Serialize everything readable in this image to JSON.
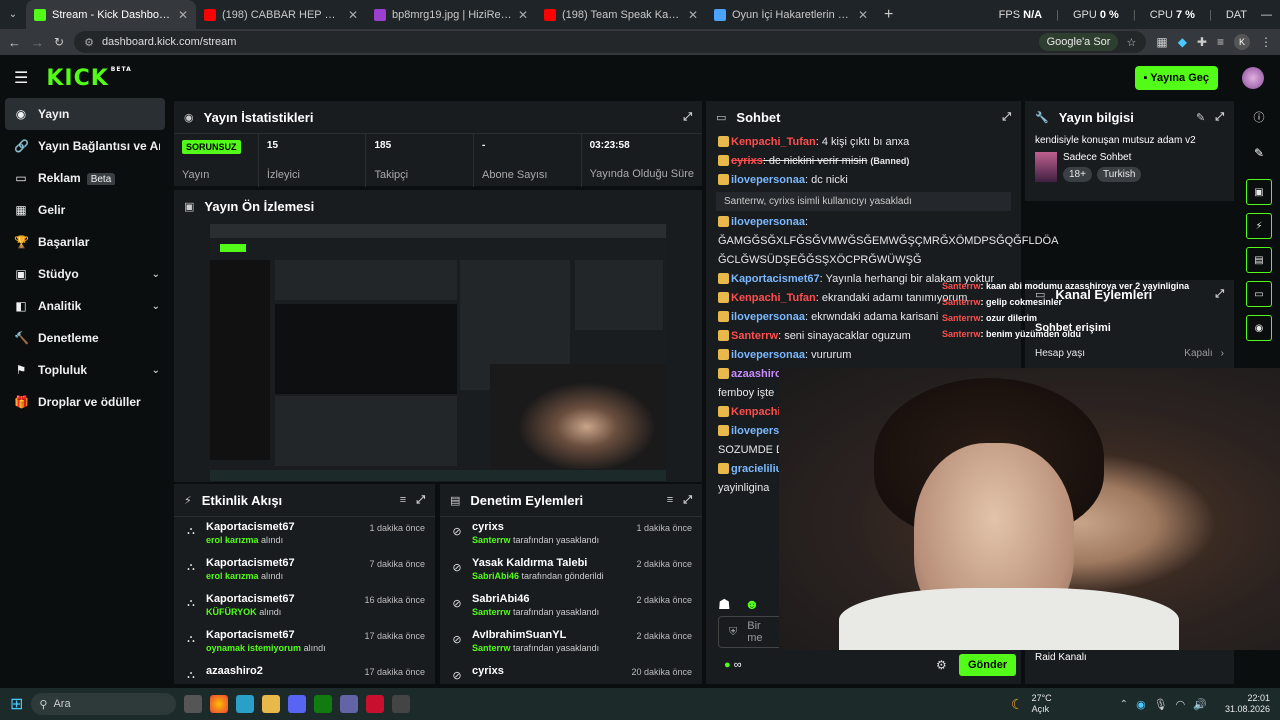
{
  "browser": {
    "tabs": [
      {
        "title": "Stream - Kick Dashboard",
        "color": "#53fc18",
        "active": true
      },
      {
        "title": "(198) CABBAR HEP HAKLIYDI - ",
        "color": "#ff0000"
      },
      {
        "title": "bp8mrg19.jpg | HiziResim",
        "color": "#9b3fd1"
      },
      {
        "title": "(198) Team Speak Kavga [Kopti",
        "color": "#ff0000"
      },
      {
        "title": "Oyun İçi Hakaretlerin Hukuki Bo",
        "color": "#4aa3ff"
      }
    ],
    "stats": {
      "fps_label": "FPS",
      "fps": "N/A",
      "gpu_label": "GPU",
      "gpu": "0 %",
      "cpu_label": "CPU",
      "cpu": "7 %",
      "dat_label": "DAT"
    },
    "url": "dashboard.kick.com/stream",
    "google_button": "Google'a Sor",
    "profile_initial": "K"
  },
  "header": {
    "logo": "KICK",
    "logo_sup": "BETA",
    "go_live": "Yayına Geç"
  },
  "sidebar": {
    "items": [
      {
        "label": "Yayın",
        "icon": "◉",
        "active": true
      },
      {
        "label": "Yayın Bağlantısı ve Anahtar",
        "icon": "🔗"
      },
      {
        "label": "Reklam",
        "icon": "▭",
        "badge": "Beta"
      },
      {
        "label": "Gelir",
        "icon": "▦"
      },
      {
        "label": "Başarılar",
        "icon": "🏆"
      },
      {
        "label": "Stüdyo",
        "icon": "▣",
        "chevron": true
      },
      {
        "label": "Analitik",
        "icon": "◧",
        "chevron": true
      },
      {
        "label": "Denetleme",
        "icon": "🔨"
      },
      {
        "label": "Topluluk",
        "icon": "⚑",
        "chevron": true
      },
      {
        "label": "Droplar ve ödüller",
        "icon": "🎁"
      }
    ]
  },
  "stats_panel": {
    "title": "Yayın İstatistikleri",
    "status_badge": "SORUNSUZ",
    "status_label": "Yayın",
    "items": [
      {
        "value": "15",
        "label": "İzleyici"
      },
      {
        "value": "185",
        "label": "Takipçi"
      },
      {
        "value": "-",
        "label": "Abone Sayısı"
      },
      {
        "value": "03:23:58",
        "label": "Yayında Olduğu Süre"
      }
    ]
  },
  "preview_panel": {
    "title": "Yayın Ön İzlemesi"
  },
  "activity_panel": {
    "title": "Etkinlik Akışı",
    "rows": [
      {
        "name": "Kaportacismet67",
        "highlight": "erol karızma",
        "suffix": "alındı",
        "time": "1 dakika önce"
      },
      {
        "name": "Kaportacismet67",
        "highlight": "erol karızma",
        "suffix": "alındı",
        "time": "7 dakika önce"
      },
      {
        "name": "Kaportacismet67",
        "highlight": "KÜFÜRYOK",
        "suffix": "alındı",
        "time": "16 dakika önce"
      },
      {
        "name": "Kaportacismet67",
        "highlight": "oynamak istemiyorum",
        "suffix": "alındı",
        "time": "17 dakika önce"
      },
      {
        "name": "azaashiro2",
        "highlight": "",
        "suffix": "",
        "time": "17 dakika önce"
      }
    ]
  },
  "moderation_panel": {
    "title": "Denetim Eylemleri",
    "rows": [
      {
        "name": "cyrixs",
        "highlight": "Santerrw",
        "suffix": "tarafından yasaklandı",
        "time": "1 dakika önce"
      },
      {
        "name": "Yasak Kaldırma Talebi",
        "highlight": "SabriAbi46",
        "suffix": "tarafından gönderildi",
        "time": "2 dakika önce"
      },
      {
        "name": "SabriAbi46",
        "highlight": "Santerrw",
        "suffix": "tarafından yasaklandı",
        "time": "2 dakika önce"
      },
      {
        "name": "AvIbrahimSuanYL",
        "highlight": "Santerrw",
        "suffix": "tarafından yasaklandı",
        "time": "2 dakika önce"
      },
      {
        "name": "cyrixs",
        "highlight": "",
        "suffix": "",
        "time": "20 dakika önce"
      }
    ]
  },
  "chat_panel": {
    "title": "Sohbet",
    "messages": [
      {
        "user": "Kenpachi_Tufan",
        "color": "#ff4d4d",
        "text": ": 4 kişi çıktı bı anxa"
      },
      {
        "user": "cyrixs",
        "color": "#ff4d4d",
        "text": ": dc nickini verir misin",
        "note": "(Banned)",
        "struck": true
      },
      {
        "user": "ilovepersonaa",
        "color": "#7ab8ff",
        "text": ": dc nicki"
      },
      {
        "system": "Santerrw, cyrixs isimli kullanıcıyı yasakladı"
      },
      {
        "user": "ilovepersonaa",
        "color": "#7ab8ff",
        "text": ":"
      },
      {
        "text": "ĞAMGĞSĞXLFĞSĞVMWĞSĞEMWĞŞÇMRĞXÖMDPSĞQĞFLDÖA"
      },
      {
        "text": "ĞCLĞWSÜDŞEĞĞSŞXÖCPRĞWÜWŞĞ"
      },
      {
        "user": "Kaportacismet67",
        "color": "#7ab8ff",
        "text": ": Yayınla herhangi bir alakam yoktur"
      },
      {
        "user": "Kenpachi_Tufan",
        "color": "#ff4d4d",
        "text": ": ekrandaki adamı tanımıyorum"
      },
      {
        "user": "ilovepersonaa",
        "color": "#7ab8ff",
        "text": ": ekrwndaki adama karisani"
      },
      {
        "user": "Santerrw",
        "color": "#ff4d4d",
        "text": ": seni sinayacaklar oguzum"
      },
      {
        "user": "ilovepersonaa",
        "color": "#7ab8ff",
        "text": ": vururum"
      },
      {
        "user": "azaashiro",
        "color": "#c98bff",
        "text": ""
      },
      {
        "text": "femboy işte"
      },
      {
        "user": "Kenpachi_",
        "color": "#ff4d4d",
        "text": ""
      },
      {
        "user": "ilovepers",
        "color": "#7ab8ff",
        "text": ""
      },
      {
        "text": "SOZUMDE DE"
      },
      {
        "user": "gracieliliu",
        "color": "#7ab8ff",
        "text": ""
      },
      {
        "text": "yayinligina"
      }
    ],
    "input_placeholder": "Bir me",
    "send_button": "Gönder"
  },
  "info_panel": {
    "title": "Yayın bilgisi",
    "stream_title": "kendisiyle konuşan mutsuz adam v2",
    "category": "Sadece Sohbet",
    "tags": [
      "18+",
      "Turkish"
    ]
  },
  "channel_actions": {
    "title": "Kanal Eylemleri",
    "chat_access": "Sohbet erişimi",
    "account_age_label": "Hesap yaşı",
    "account_age_value": "Kapalı",
    "raid": "Raid Kanalı"
  },
  "overlay_chat": [
    {
      "user": "Santerrw",
      "text": ": kaan abi modumu azasshiroya ver 2 yayinligina"
    },
    {
      "user": "Santerrw",
      "text": ": gelip cokmesinler"
    },
    {
      "user": "Santerrw",
      "text": ": ozur dilerim"
    },
    {
      "user": "Santerrw",
      "text": ": benim yüzümden oldu"
    }
  ],
  "taskbar": {
    "search_placeholder": "Ara",
    "weather_temp": "27°C",
    "weather_desc": "Açık",
    "time": "22:01",
    "date": "31.08.2026"
  }
}
